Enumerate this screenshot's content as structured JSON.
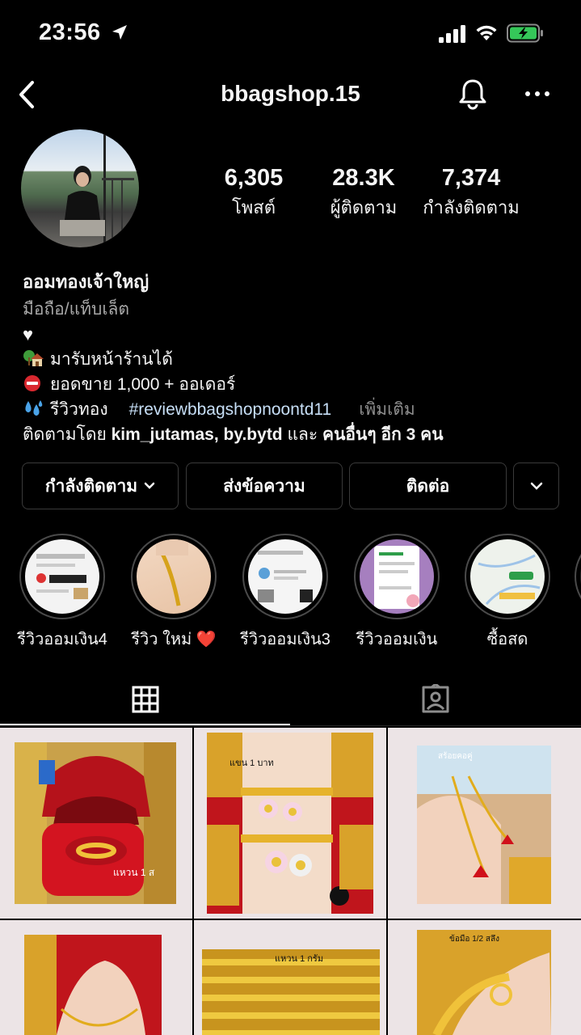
{
  "status_bar": {
    "time": "23:56"
  },
  "nav": {
    "username": "bbagshop.15"
  },
  "stats": [
    {
      "value": "6,305",
      "label": "โพสต์"
    },
    {
      "value": "28.3K",
      "label": "ผู้ติดตาม"
    },
    {
      "value": "7,374",
      "label": "กำลังติดตาม"
    }
  ],
  "bio": {
    "name": "ออมทองเจ้าใหญ่",
    "category": "มือถือ/แท็บเล็ต",
    "heart": "♥",
    "line1": "มารับหน้าร้านได้",
    "line2": "ยอดขาย 1,000 + ออเดอร์",
    "line3_text": "รีวิวทอง",
    "line3_tag": "#reviewbbagshopnoontd11",
    "more": "เพิ่มเติม",
    "followed_prefix": "ติดตามโดย",
    "followed_names": "kim_jutamas, by.bytd",
    "followed_and": "และ",
    "followed_others": "คนอื่นๆ อีก 3 คน"
  },
  "buttons": {
    "following": "กำลังติดตาม",
    "message": "ส่งข้อความ",
    "contact": "ติดต่อ"
  },
  "highlights": [
    {
      "label": "รีวิวออมเงิน4"
    },
    {
      "label": "รีวิว ใหม่ ❤️"
    },
    {
      "label": "รีวิวออมเงิน3"
    },
    {
      "label": "รีวิวออมเงิน"
    },
    {
      "label": "ซื้อสด"
    }
  ],
  "posts": [
    {
      "caption": "แหวน 1 ส"
    },
    {
      "caption": "แขน 1 บาท"
    },
    {
      "caption": "สร้อยคอคู่"
    },
    {
      "caption": ""
    },
    {
      "caption": "แหวน 1 กรัม"
    },
    {
      "caption": "ข้อมือ 1/2 สลึง"
    }
  ],
  "colors": {
    "background": "#000000",
    "link": "#c7dff7",
    "muted": "#a8a8a8",
    "border": "#3a3a3a",
    "gold": "#e8b21c",
    "red": "#d0101a"
  }
}
